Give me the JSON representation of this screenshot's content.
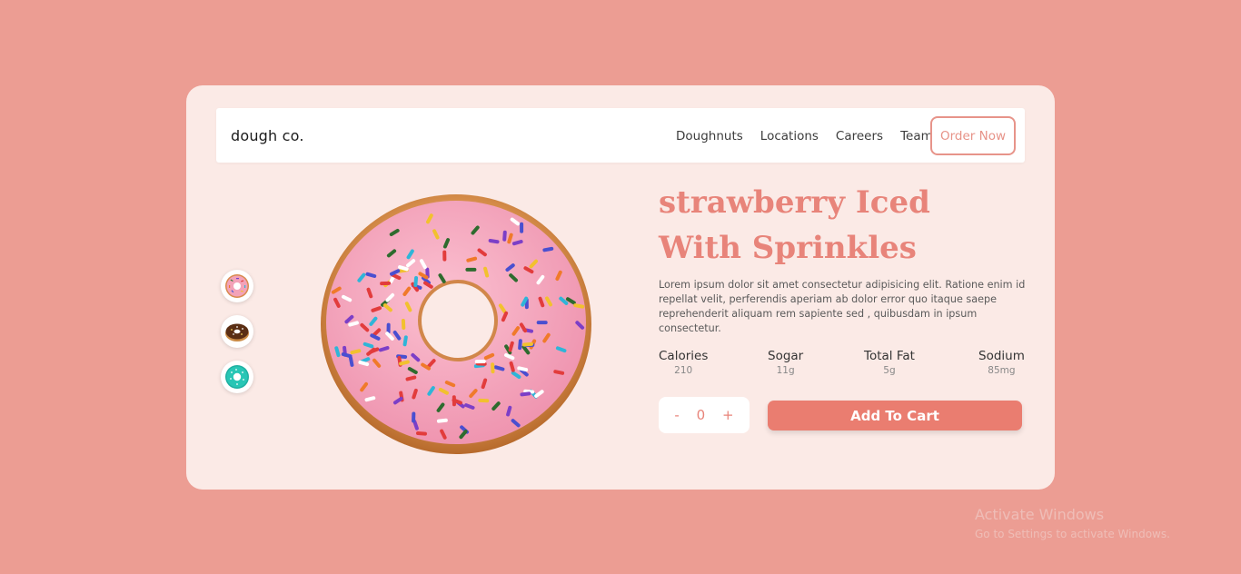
{
  "brand": "dough co.",
  "nav": {
    "links": [
      "Doughnuts",
      "Locations",
      "Careers",
      "Team"
    ],
    "cta": "Order Now"
  },
  "thumbnails": [
    {
      "name": "strawberry-donut-thumb",
      "color": "#f3a2b8"
    },
    {
      "name": "chocolate-donut-thumb",
      "color": "#6b3a1f"
    },
    {
      "name": "mint-donut-thumb",
      "color": "#28c6b5"
    }
  ],
  "product": {
    "title_line1": "strawberry Iced",
    "title_line2": "With Sprinkles",
    "description": "Lorem ipsum dolor sit amet consectetur adipisicing elit. Ratione enim id repellat velit, perferendis aperiam ab dolor error quo itaque saepe reprehenderit aliquam rem sapiente sed , quibusdam in ipsum consectetur.",
    "nutrition": [
      {
        "label": "Calories",
        "value": "210"
      },
      {
        "label": "Sogar",
        "value": "11g"
      },
      {
        "label": "Total Fat",
        "value": "5g"
      },
      {
        "label": "Sodium",
        "value": "85mg"
      }
    ]
  },
  "cart": {
    "minus": "-",
    "quantity": "0",
    "plus": "+",
    "add_label": "Add To Cart"
  },
  "watermark": {
    "line1": "Activate Windows",
    "line2": "Go to Settings to activate Windows."
  },
  "colors": {
    "background": "#ec9d93",
    "card": "#fbeae6",
    "accent": "#ea7d70",
    "title": "#e8847a"
  }
}
